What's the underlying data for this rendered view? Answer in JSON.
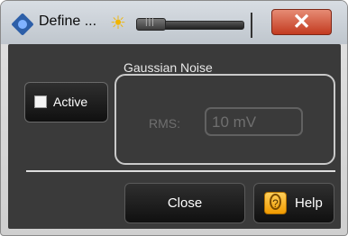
{
  "window": {
    "title": "Define ...",
    "close_symbol": "✕"
  },
  "brightness": {
    "icon": "sun-icon",
    "value_fraction": 0.0
  },
  "group": {
    "title": "Gaussian Noise"
  },
  "active": {
    "label": "Active",
    "checked": false
  },
  "rms": {
    "label": "RMS:",
    "value": "10 mV"
  },
  "buttons": {
    "close": "Close",
    "help": "Help"
  },
  "colors": {
    "dialog_bg": "#3a3a3a",
    "close_window": "#c33a20",
    "help_icon": "#f19b00"
  }
}
